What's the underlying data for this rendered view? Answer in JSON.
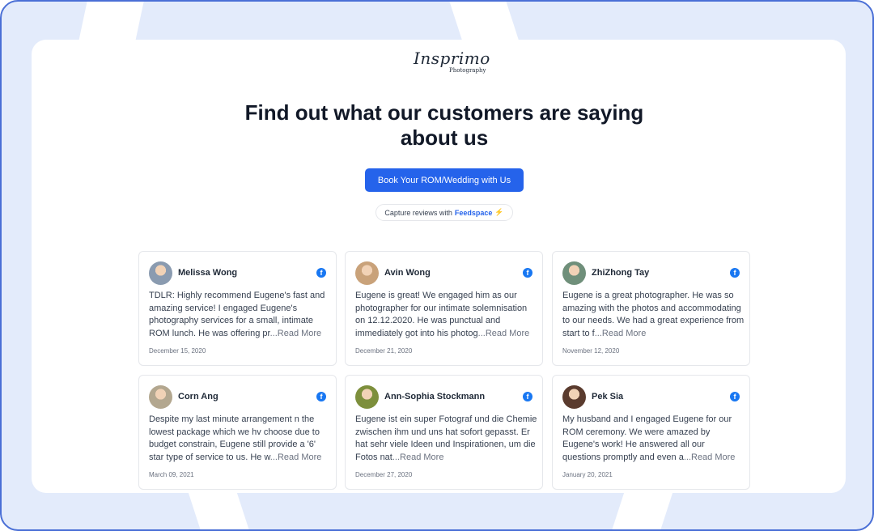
{
  "brand": {
    "name": "Insprimo",
    "sub": "Photography"
  },
  "headline": "Find out what our customers are saying about us",
  "cta_label": "Book Your ROM/Wedding with Us",
  "capture": {
    "text": "Capture reviews with",
    "brand": "Feedspace",
    "bolt": "⚡"
  },
  "read_more": "...Read More",
  "reviews": [
    {
      "name": "Melissa Wong",
      "text": "TDLR: Highly recommend Eugene's fast and amazing service! I engaged Eugene's photography services for a small, intimate ROM lunch. He was offering pr",
      "date": "December 15, 2020",
      "avatar_color": "#8a9bb0"
    },
    {
      "name": "Avin Wong",
      "text": "Eugene is great! We engaged him as our photographer for our intimate solemnisation on 12.12.2020. He was punctual and immediately got into his photog",
      "date": "December 21, 2020",
      "avatar_color": "#c9a27a"
    },
    {
      "name": "ZhiZhong Tay",
      "text": "Eugene is a great photographer. He was so amazing with the photos and accommodating to our needs. We had a great experience from start to f",
      "date": "November 12, 2020",
      "avatar_color": "#6f8f7a"
    },
    {
      "name": "Corn Ang",
      "text": "Despite my last minute arrangement n the lowest package which we hv choose due to budget constrain, Eugene still provide a '6' star type of service to us. He w",
      "date": "March 09, 2021",
      "avatar_color": "#b3a78f"
    },
    {
      "name": "Ann-Sophia Stockmann",
      "text": "Eugene ist ein super Fotograf und die Chemie zwischen ihm und uns hat sofort gepasst. Er hat sehr viele Ideen und Inspirationen, um die Fotos nat",
      "date": "December 27, 2020",
      "avatar_color": "#7d8f3c"
    },
    {
      "name": "Pek Sia",
      "text": "My husband and I engaged Eugene for our ROM ceremony. We were amazed by Eugene's work! He answered all our questions promptly and even a",
      "date": "January 20, 2021",
      "avatar_color": "#5a3b2e"
    }
  ],
  "icons": {
    "social": "facebook-icon"
  }
}
